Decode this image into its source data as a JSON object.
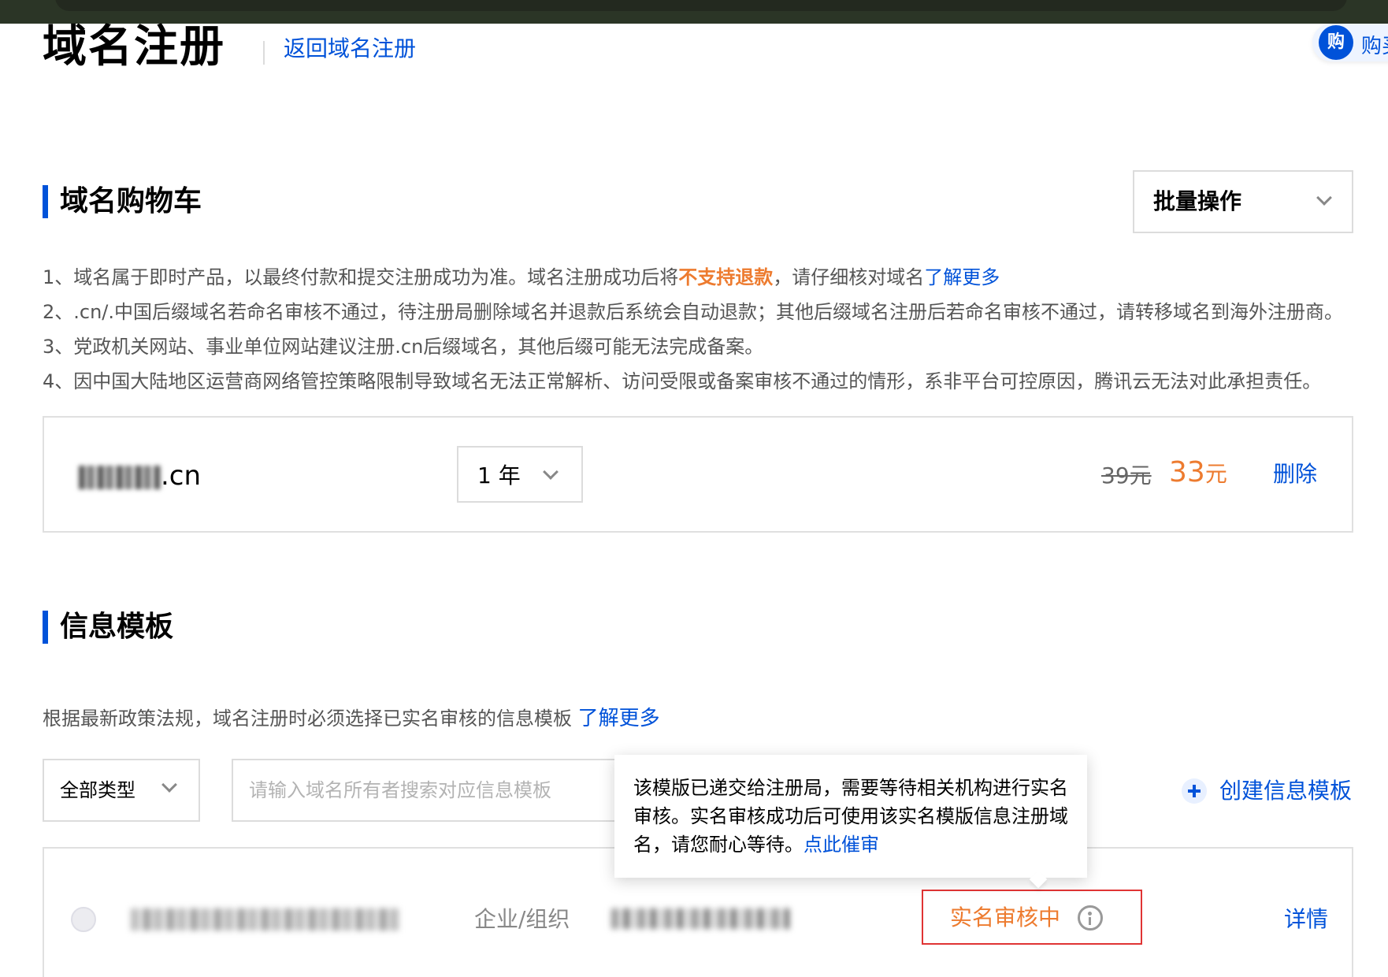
{
  "header": {
    "title": "域名注册",
    "back_link": "返回域名注册",
    "buy_float_icon": "购",
    "buy_float_label": "购买"
  },
  "cart": {
    "section_title": "域名购物车",
    "batch_label": "批量操作",
    "notices": [
      {
        "prefix": "1、域名属于即时产品，以最终付款和提交注册成功为准。域名注册成功后将",
        "warn": "不支持退款",
        "mid": "，请仔细核对域名",
        "link": "了解更多"
      },
      {
        "text": "2、.cn/.中国后缀域名若命名审核不通过，待注册局删除域名并退款后系统会自动退款；其他后缀域名注册后若命名审核不通过，请转移域名到海外注册商。"
      },
      {
        "text": "3、党政机关网站、事业单位网站建议注册.cn后缀域名，其他后缀可能无法完成备案。"
      },
      {
        "text": "4、因中国大陆地区运营商网络管控策略限制导致域名无法正常解析、访问受限或备案审核不通过的情形，系非平台可控原因，腾讯云无法对此承担责任。"
      }
    ],
    "item": {
      "domain_suffix": ".cn",
      "period": "1 年",
      "price_original": "39元",
      "price_current": "33",
      "price_unit": "元",
      "delete_label": "删除"
    }
  },
  "template": {
    "section_title": "信息模板",
    "description": "根据最新政策法规，域名注册时必须选择已实名审核的信息模板 ",
    "description_link": "了解更多",
    "type_filter": "全部类型",
    "search_placeholder": "请输入域名所有者搜索对应信息模板",
    "create_label": "创建信息模板",
    "row": {
      "type": "企业/组织",
      "status": "实名审核中",
      "detail_label": "详情"
    },
    "tooltip": {
      "text": "该模版已递交给注册局，需要等待相关机构进行实名审核。实名审核成功后可使用该实名模版信息注册域名，请您耐心等待。",
      "link": "点此催审"
    }
  },
  "colors": {
    "accent": "#0052d9",
    "warning": "#ed7b2f",
    "highlight_border": "#e03434"
  }
}
